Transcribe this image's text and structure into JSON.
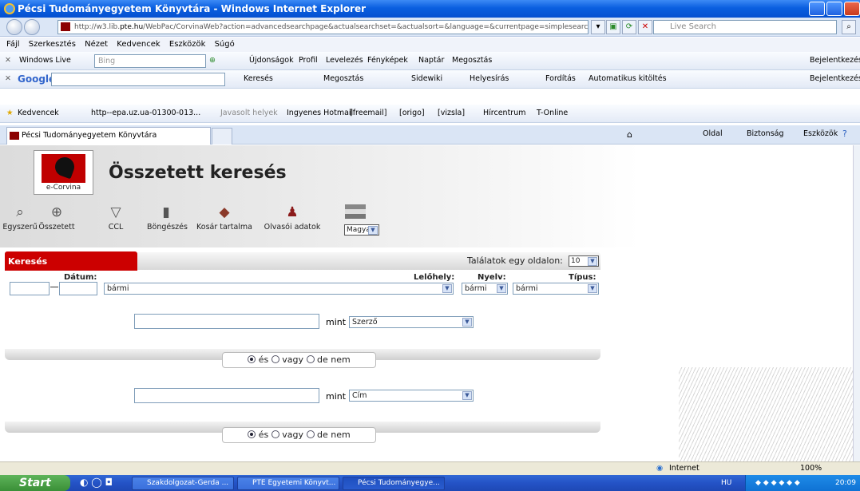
{
  "window": {
    "title": "Pécsi Tudományegyetem Könyvtára - Windows Internet Explorer"
  },
  "address": {
    "url_pre": "http://w3.lib.",
    "url_bold": "pte.hu",
    "url_post": "/WebPac/CorvinaWeb?action=advancedsearchpage&actualsearchset=&actualsort=&language=&currentpage=simplesearchpage",
    "search_placeholder": "Live Search"
  },
  "menu": [
    "Fájl",
    "Szerkesztés",
    "Nézet",
    "Kedvencek",
    "Eszközök",
    "Súgó"
  ],
  "liveBar": {
    "label": "Windows Live",
    "search_placeholder": "Bing",
    "links": [
      "Újdonságok",
      "Profil",
      "Levelezés",
      "Fényképek",
      "Naptár",
      "Megosztás"
    ],
    "signin": "Bejelentkezés"
  },
  "googleBar": {
    "label": "Google",
    "items": [
      "Keresés",
      "Megosztás",
      "Sidewiki",
      "Helyesírás",
      "Fordítás",
      "Automatikus kitöltés"
    ],
    "signin": "Bejelentkezés"
  },
  "favBar": {
    "label": "Kedvencek",
    "items": [
      "http--epa.uz.ua-01300-013...",
      "Javasolt helyek",
      "Ingyenes Hotmail",
      "[freemail]",
      "[origo]",
      "[vizsla]",
      "Hírcentrum",
      "T-Online"
    ]
  },
  "tabs": {
    "active": "Pécsi Tudományegyetem Könyvtára",
    "cmdbar": [
      "Oldal",
      "Biztonság",
      "Eszközök"
    ]
  },
  "page": {
    "logo_text": "e-Corvina",
    "title": "Összetett keresés",
    "nav": [
      "Egyszerű",
      "Összetett",
      "CCL",
      "Böngészés",
      "Kosár tartalma",
      "Olvasói adatok"
    ],
    "language": "Magyar",
    "panel_title": "Keresés",
    "per_page_label": "Találatok egy oldalon:",
    "per_page_value": "10",
    "headers": {
      "date": "Dátum:",
      "location": "Lelőhely:",
      "lang": "Nyelv:",
      "type": "Típus:"
    },
    "location_value": "bármi",
    "lang_value": "bármi",
    "type_value": "bármi",
    "row1": {
      "mint": "mint",
      "field": "Szerző"
    },
    "row2": {
      "mint": "mint",
      "field": "Cím"
    },
    "bool": {
      "and": "és",
      "or": "vagy",
      "not": "de nem"
    }
  },
  "statusbar": {
    "zone": "Internet",
    "zoom": "100%"
  },
  "taskbar": {
    "start": "Start",
    "tasks": [
      "Szakdolgozat-Gerda ...",
      "PTE Egyetemi Könyvt...",
      "Pécsi Tudományegye..."
    ],
    "lang": "HU",
    "clock": "20:09"
  }
}
